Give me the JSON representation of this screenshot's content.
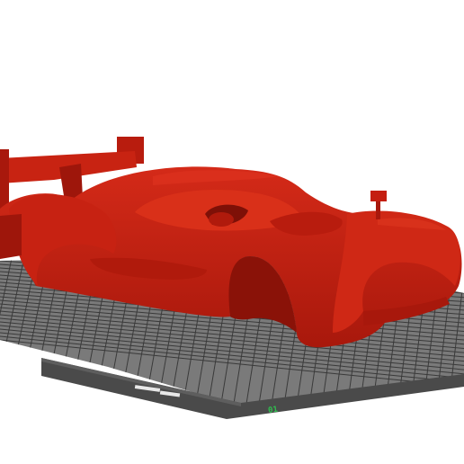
{
  "viewport": {
    "background": "#ffffff"
  },
  "build_plate": {
    "label": "01",
    "label_color": "#2fbf4f",
    "surface_color": "#7a7a7a",
    "grid_color": "#3a3a3a",
    "edge_color": "#4a4a4a"
  },
  "model": {
    "name": "prototype-race-car-body",
    "color": "#c41e10",
    "shadow_color": "#8a1208",
    "highlight_color": "#e0341f"
  }
}
